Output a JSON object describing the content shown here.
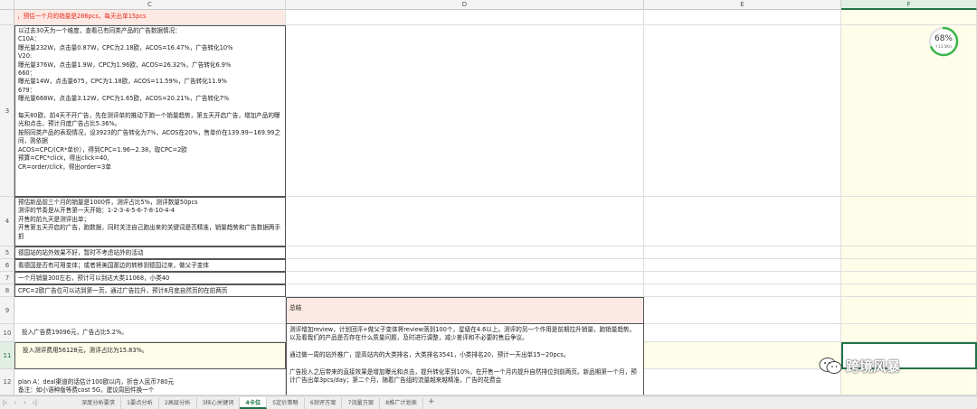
{
  "columns": [
    {
      "id": "colC",
      "label": "C"
    },
    {
      "id": "colD",
      "label": "D"
    },
    {
      "id": "colE",
      "label": "E"
    },
    {
      "id": "colF",
      "label": "F"
    }
  ],
  "rows": [
    "3",
    "4",
    "5",
    "6",
    "7",
    "8",
    "9",
    "10",
    "11",
    "12"
  ],
  "cells": {
    "r2_c": "，预估一个月的销量是286pcs，每天出单15pcs",
    "r3_c": "以过去30天为一个维度，查看已有同类产品的广告数据情况：\nC10A：\n曝光量232W，点击量0.87W，CPC为2.18欧，ACOS=16.47%，广告转化10%\nV20:\n曝光量376W，点击量1.9W，CPC为1.96欧，ACOS=26.32%，广告转化6.9%\n660：\n曝光量14W，点击量675，CPC为1.18欧，ACOS=11.59%，广告转化11.9%\n679：\n曝光量668W，点击量3.12W，CPC为1.65欧，ACOS=20.21%，广告转化7%\n\n每天80欧，前4天不开广告，先在测评单的推动下跑一个销量趋势，第五天开启广告，增加产品的曝光和点击，预计月度广告占比5.36%。\n按照同类产品的表现情况，设3923的广告转化为7%，ACOS在20%，售单价在139.99~169.99之间，则依据\nACOS=CPC/(CR*单价），得到CPC=1.96~2.38，取CPC=2欧\n预算=CPC*click，得出click=40,\nCR=order/click，得出order=3单",
    "r4_c": "预估新品前三个月的销量是1000件，测评占比5%，测评数量50pcs\n测评的节奏是从开售第一天开始：1-2-3-4-5-6-7-8-10-4-4\n开售的前九天是测评出单；\n开售第五天开启的广告，跑数据，同时关注自己跑出来的关键词是否精准，销量趋势和广告数据两手抓",
    "r5_c": "德国站的站外效果不好，暂时不考虑站外的活动",
    "r6_c": "看德国是否有可用变体；或者将美国那边的转移到德国过来，做父子变体",
    "r7_c": "一个月销量300左右，预计可以到达大类11068，小类40",
    "r8_c": "CPC=2欧广告位可以达到第一页，通过广告拉升，预计8月底自然页的在前两页",
    "r9_d": "总结",
    "r10_c": "投入广告费19096元，广告占比5.2%。",
    "r10_d": "测评增加review，计划回评+做父子变体将review落到100个，星级在4.6以上。测评的另一个作用是前期拉升销量，跑销量趋势。以及看我们的产品是否存在什么质量问题，及时进行调整，减少差评和不必要的售后争议。\n\n通过做一周的站外推广，提高站内的大类排名，大类排名3541，小类排名20，预计一天出单15~20pcs。\n\n广告投入之后带来的直接效果是增加曝光和点击，提升转化率到10%，在开售一个月内提升自然排位到前两页。新品期第一个月，预计广告出单3pcs/day；第二个月，随着广告组的流量越来越精准，广告的花费会",
    "r11_c": "投入测评费用56128元，测评占比为15.83%。",
    "r12_c": "plan A：deal渠道的话估计100欧以内，折合人民币780元\n备注：如小语种版等费cost 5G，建议周回件换一个"
  },
  "progress": {
    "percent": 68,
    "label": "68%",
    "speed": "↑13.5K/s",
    "color": "#3bb54a"
  },
  "sheet_tabs": [
    {
      "label": "深度分析要求",
      "active": false
    },
    {
      "label": "1要点分析",
      "active": false
    },
    {
      "label": "2高层分析",
      "active": false
    },
    {
      "label": "3核心关键词",
      "active": false
    },
    {
      "label": "4卡位",
      "active": true
    },
    {
      "label": "5定价策略",
      "active": false
    },
    {
      "label": "6测评方案",
      "active": false
    },
    {
      "label": "7流量方案",
      "active": false
    },
    {
      "label": "8推广计划表",
      "active": false
    }
  ],
  "watermark": {
    "text": "跨境风暴",
    "icon": "wechat-icon"
  },
  "colors": {
    "accent": "#217346",
    "highlight_red": "#e52a1a",
    "yellow_col": "#fefde9"
  }
}
